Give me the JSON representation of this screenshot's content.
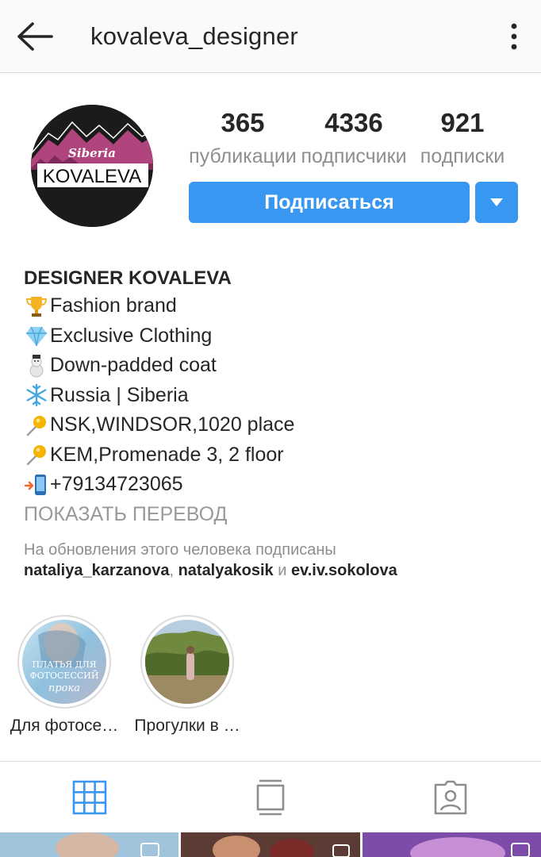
{
  "header": {
    "title": "kovaleva_designer"
  },
  "profile": {
    "avatar_text": "KOVALEVA",
    "avatar_subtext": "Siberia",
    "stats": [
      {
        "value": "365",
        "label": "публикации"
      },
      {
        "value": "4336",
        "label": "подписчики"
      },
      {
        "value": "921",
        "label": "подписки"
      }
    ],
    "follow_label": "Подписаться"
  },
  "bio": {
    "name": "DESIGNER KOVALEVA",
    "lines": [
      {
        "icon": "trophy-icon",
        "text": "Fashion brand"
      },
      {
        "icon": "diamond-icon",
        "text": "Exclusive Clothing"
      },
      {
        "icon": "snowman-icon",
        "text": "Down-padded coat"
      },
      {
        "icon": "snowflake-icon",
        "text": "Russia | Siberia"
      },
      {
        "icon": "pushpin-icon",
        "text": "NSK,WINDSOR,1020 place"
      },
      {
        "icon": "pushpin-icon",
        "text": "KEM,Promenade 3, 2 floor"
      },
      {
        "icon": "phone-arrow-icon",
        "text": "+79134723065"
      }
    ],
    "translate_label": "ПОКАЗАТЬ ПЕРЕВОД",
    "followed_by_text": "На обновления этого человека подписаны",
    "followed_by_users": [
      "nataliya_karzanova",
      "natalyakosik",
      "ev.iv.sokolova"
    ],
    "separator_comma": ", ",
    "separator_and": " и "
  },
  "highlights": [
    {
      "label": "Для фотосе…",
      "overlay_text_1": "ПЛАТЬЯ ДЛЯ",
      "overlay_text_2": "ФОТОСЕССИЙ",
      "overlay_text_3": "прока"
    },
    {
      "label": "Прогулки в …"
    }
  ],
  "tabs": [
    {
      "icon": "grid-icon",
      "active": true
    },
    {
      "icon": "feed-icon",
      "active": false
    },
    {
      "icon": "tagged-icon",
      "active": false
    }
  ],
  "colors": {
    "accent": "#3897f0",
    "text": "#262626",
    "muted": "#8e8e8e"
  }
}
